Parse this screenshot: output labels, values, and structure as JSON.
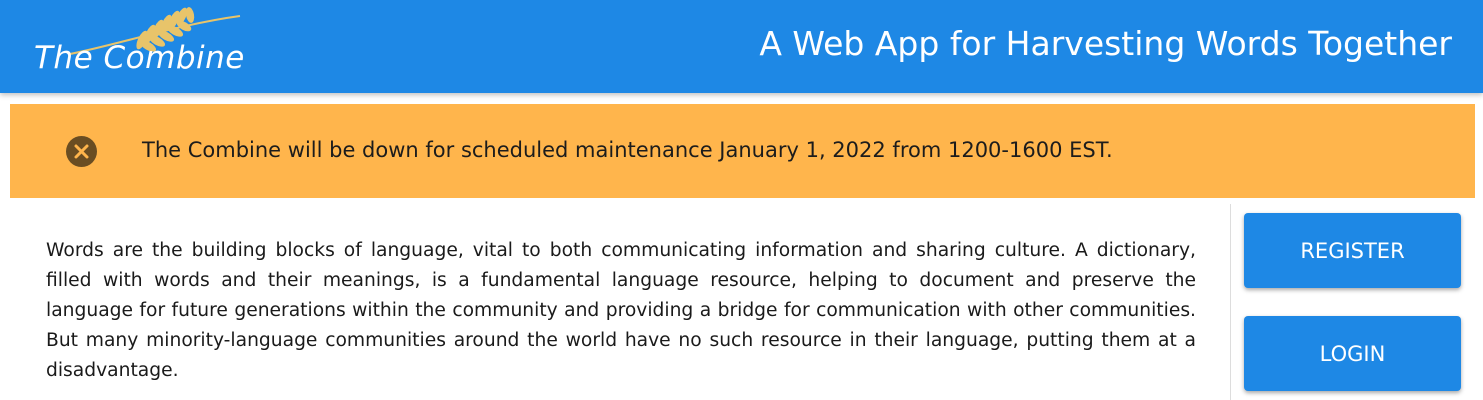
{
  "header": {
    "logo_text": "The Combine",
    "title": "A Web App for Harvesting Words Together",
    "background_color": "#1e88e5"
  },
  "banner": {
    "icon": "close-circle-icon",
    "message": "The Combine will be down for scheduled maintenance January 1, 2022 from 1200-1600 EST.",
    "background_color": "#ffb54c"
  },
  "main": {
    "intro": "Words are the building blocks of language, vital to both communicating information and sharing culture. A dictionary, filled with words and their meanings, is a fundamental language resource, helping to document and preserve the language for future generations within the community and providing a bridge for communication with other communities. But many minority-language communities around the world have no such resource in their language, putting them at a disadvantage."
  },
  "sidebar": {
    "register_label": "REGISTER",
    "login_label": "LOGIN"
  }
}
